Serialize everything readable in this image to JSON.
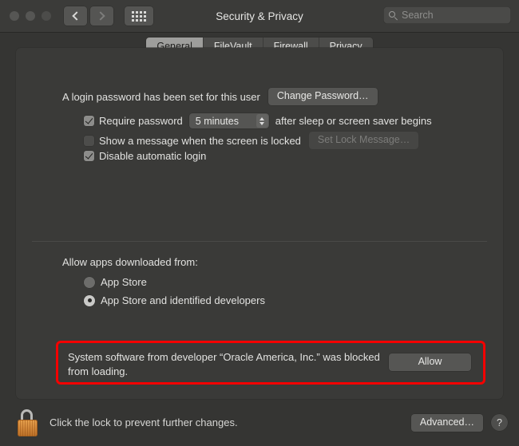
{
  "window": {
    "title": "Security & Privacy",
    "traffic_lights": [
      "close",
      "minimize",
      "zoom"
    ],
    "nav": {
      "back_icon": "chevron-left-icon",
      "forward_icon": "chevron-right-icon",
      "grid_icon": "grid-dots-icon"
    },
    "search": {
      "value": "",
      "placeholder": "Search",
      "icon": "search-icon"
    }
  },
  "tabs": [
    {
      "label": "General",
      "active": true
    },
    {
      "label": "FileVault",
      "active": false
    },
    {
      "label": "Firewall",
      "active": false
    },
    {
      "label": "Privacy",
      "active": false
    }
  ],
  "general": {
    "password_status": "A login password has been set for this user",
    "change_password_button": "Change Password…",
    "require_password": {
      "label": "Require password",
      "checked": true,
      "interval_value": "5 minutes",
      "suffix": "after sleep or screen saver begins"
    },
    "lock_message": {
      "label": "Show a message when the screen is locked",
      "checked": false,
      "button": "Set Lock Message…",
      "button_disabled": true
    },
    "disable_auto_login": {
      "label": "Disable automatic login",
      "checked": true
    },
    "allow_apps_heading": "Allow apps downloaded from:",
    "allow_apps_options": [
      {
        "label": "App Store",
        "selected": false
      },
      {
        "label": "App Store and identified developers",
        "selected": true
      }
    ],
    "blocked_alert": {
      "message": "System software from developer “Oracle America, Inc.” was blocked from loading.",
      "button": "Allow",
      "highlight_color": "#f50000"
    }
  },
  "footer": {
    "lock_icon": "open-padlock-icon",
    "lock_text": "Click the lock to prevent further changes.",
    "advanced_button": "Advanced…",
    "help_button": "?"
  }
}
